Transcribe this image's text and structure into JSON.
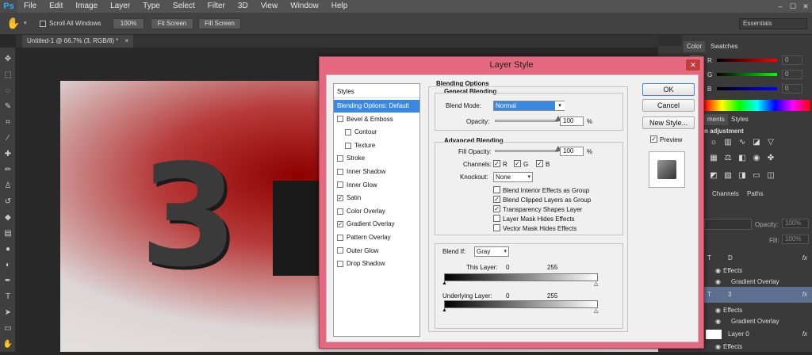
{
  "app": {
    "logo": "Ps"
  },
  "menu": [
    "File",
    "Edit",
    "Image",
    "Layer",
    "Type",
    "Select",
    "Filter",
    "3D",
    "View",
    "Window",
    "Help"
  ],
  "window_controls": [
    "–",
    "☐",
    "✕"
  ],
  "options": {
    "tool_icon": "hand-icon",
    "scroll_all": "Scroll All Windows",
    "zoom100": "100%",
    "fit_screen": "Fit Screen",
    "fill_screen": "Fill Screen",
    "workspace": "Essentials"
  },
  "document": {
    "tab": "Untitled-1 @ 66.7% (3, RGB/8) *",
    "close": "×"
  },
  "canvas": {
    "big_text": "3"
  },
  "dialog": {
    "title": "Layer Style",
    "close": "✕",
    "styles_header": "Styles",
    "styles": [
      {
        "label": "Blending Options: Default",
        "selected": true,
        "checkbox": false,
        "checked": false
      },
      {
        "label": "Bevel & Emboss",
        "checkbox": true,
        "checked": false
      },
      {
        "label": "Contour",
        "checkbox": true,
        "checked": false,
        "indent": true
      },
      {
        "label": "Texture",
        "checkbox": true,
        "checked": false,
        "indent": true
      },
      {
        "label": "Stroke",
        "checkbox": true,
        "checked": false
      },
      {
        "label": "Inner Shadow",
        "checkbox": true,
        "checked": false
      },
      {
        "label": "Inner Glow",
        "checkbox": true,
        "checked": false
      },
      {
        "label": "Satin",
        "checkbox": true,
        "checked": true
      },
      {
        "label": "Color Overlay",
        "checkbox": true,
        "checked": false
      },
      {
        "label": "Gradient Overlay",
        "checkbox": true,
        "checked": true
      },
      {
        "label": "Pattern Overlay",
        "checkbox": true,
        "checked": false
      },
      {
        "label": "Outer Glow",
        "checkbox": true,
        "checked": false
      },
      {
        "label": "Drop Shadow",
        "checkbox": true,
        "checked": false
      }
    ],
    "blending_options": "Blending Options",
    "general_blending": "General Blending",
    "blend_mode_label": "Blend Mode:",
    "blend_mode": "Normal",
    "opacity_label": "Opacity:",
    "opacity": "100",
    "opacity_level": 1.0,
    "percent": "%",
    "advanced_blending": "Advanced Blending",
    "fill_opacity_label": "Fill Opacity:",
    "fill_opacity": "100",
    "fill_opacity_level": 1.0,
    "channels_label": "Channels:",
    "channels": [
      "R",
      "G",
      "B"
    ],
    "knockout_label": "Knockout:",
    "knockout": "None",
    "check": "✓",
    "options": [
      {
        "label": "Blend Interior Effects as Group",
        "checked": false
      },
      {
        "label": "Blend Clipped Layers as Group",
        "checked": true
      },
      {
        "label": "Transparency Shapes Layer",
        "checked": true
      },
      {
        "label": "Layer Mask Hides Effects",
        "checked": false
      },
      {
        "label": "Vector Mask Hides Effects",
        "checked": false
      }
    ],
    "blend_if_label": "Blend If:",
    "blend_if": "Gray",
    "this_layer_label": "This Layer:",
    "this_layer_min": "0",
    "this_layer_max": "255",
    "underlying_label": "Underlying Layer:",
    "underlying_min": "0",
    "underlying_max": "255",
    "ok": "OK",
    "cancel": "Cancel",
    "new_style": "New Style...",
    "preview_label": "Preview",
    "preview_checked": true
  },
  "right_panel": {
    "color_tab": "Color",
    "swatches_tab": "Swatches",
    "r": "R",
    "g": "G",
    "b": "B",
    "r_value": "0",
    "g_value": "0",
    "b_value": "0",
    "adjustments_tab": "ments",
    "styles_tab": "Styles",
    "add_adjustment": "n adjustment",
    "channels_tab": "Channels",
    "paths_tab": "Paths",
    "opacity_label": "Opacity:",
    "opacity_value": "100%",
    "fill_label": "Fill:",
    "fill_value": "100%",
    "layers": [
      {
        "name": "D",
        "type": "T",
        "fx": "fx",
        "selected": false
      },
      {
        "name": "Effects",
        "type": "effects",
        "selected": false
      },
      {
        "name": "Gradient Overlay",
        "type": "effect",
        "selected": false
      },
      {
        "name": "3",
        "type": "T",
        "fx": "fx",
        "selected": true
      },
      {
        "name": "Effects",
        "type": "effects",
        "selected": false
      },
      {
        "name": "Gradient Overlay",
        "type": "effect",
        "selected": false
      },
      {
        "name": "Layer 0",
        "type": "pixel",
        "fx": "fx",
        "selected": false
      },
      {
        "name": "Effects",
        "type": "effects",
        "selected": false
      }
    ]
  }
}
